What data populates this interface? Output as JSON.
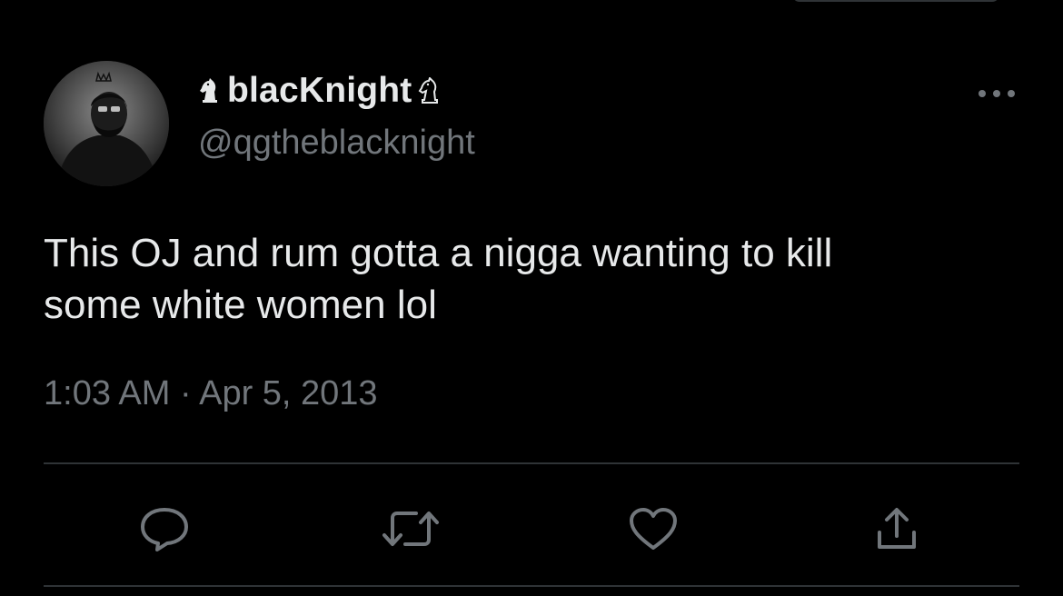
{
  "tweet": {
    "display_name": "blacKnight",
    "handle": "@qgtheblacknight",
    "text_lines": [
      "This OJ and rum gotta a nigga wanting to kill",
      "some white women lol"
    ],
    "timestamp": "1:03 AM · Apr 5, 2013"
  },
  "icons": {
    "name_prefix": "chess-knight-icon",
    "name_suffix": "chess-knight-icon",
    "more": "more-icon",
    "reply": "reply-icon",
    "retweet": "retweet-icon",
    "like": "like-icon",
    "share": "share-icon"
  },
  "colors": {
    "background": "#000000",
    "primary_text": "#e7e9ea",
    "secondary_text": "#71767b",
    "divider": "#2f3336"
  }
}
